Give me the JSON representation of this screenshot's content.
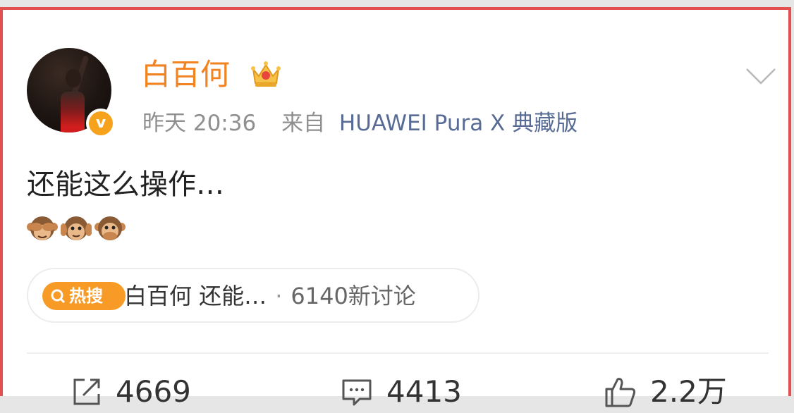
{
  "post": {
    "username": "白百何",
    "timestamp": "昨天 20:36",
    "from_label": "来自",
    "device": "HUAWEI Pura X 典藏版",
    "text": "还能这么操作…",
    "emojis": [
      "see-no-evil-monkey",
      "hear-no-evil-monkey",
      "speak-no-evil-monkey"
    ]
  },
  "hot_search": {
    "tag_label": "热搜",
    "topic": "白百何 还能…",
    "separator": "·",
    "discussion_count": "6140新讨论"
  },
  "actions": {
    "share_count": "4669",
    "comment_count": "4413",
    "like_count": "2.2万"
  },
  "colors": {
    "username": "#f28321",
    "device_link": "#576b95",
    "hot_tag": "#f79a26",
    "frame_border": "#e2504f"
  },
  "icons": {
    "verified": "verified-badge-icon",
    "vip": "crown-icon",
    "menu": "chevron-down-icon",
    "share": "share-icon",
    "comment": "comment-icon",
    "like": "thumbs-up-icon"
  }
}
